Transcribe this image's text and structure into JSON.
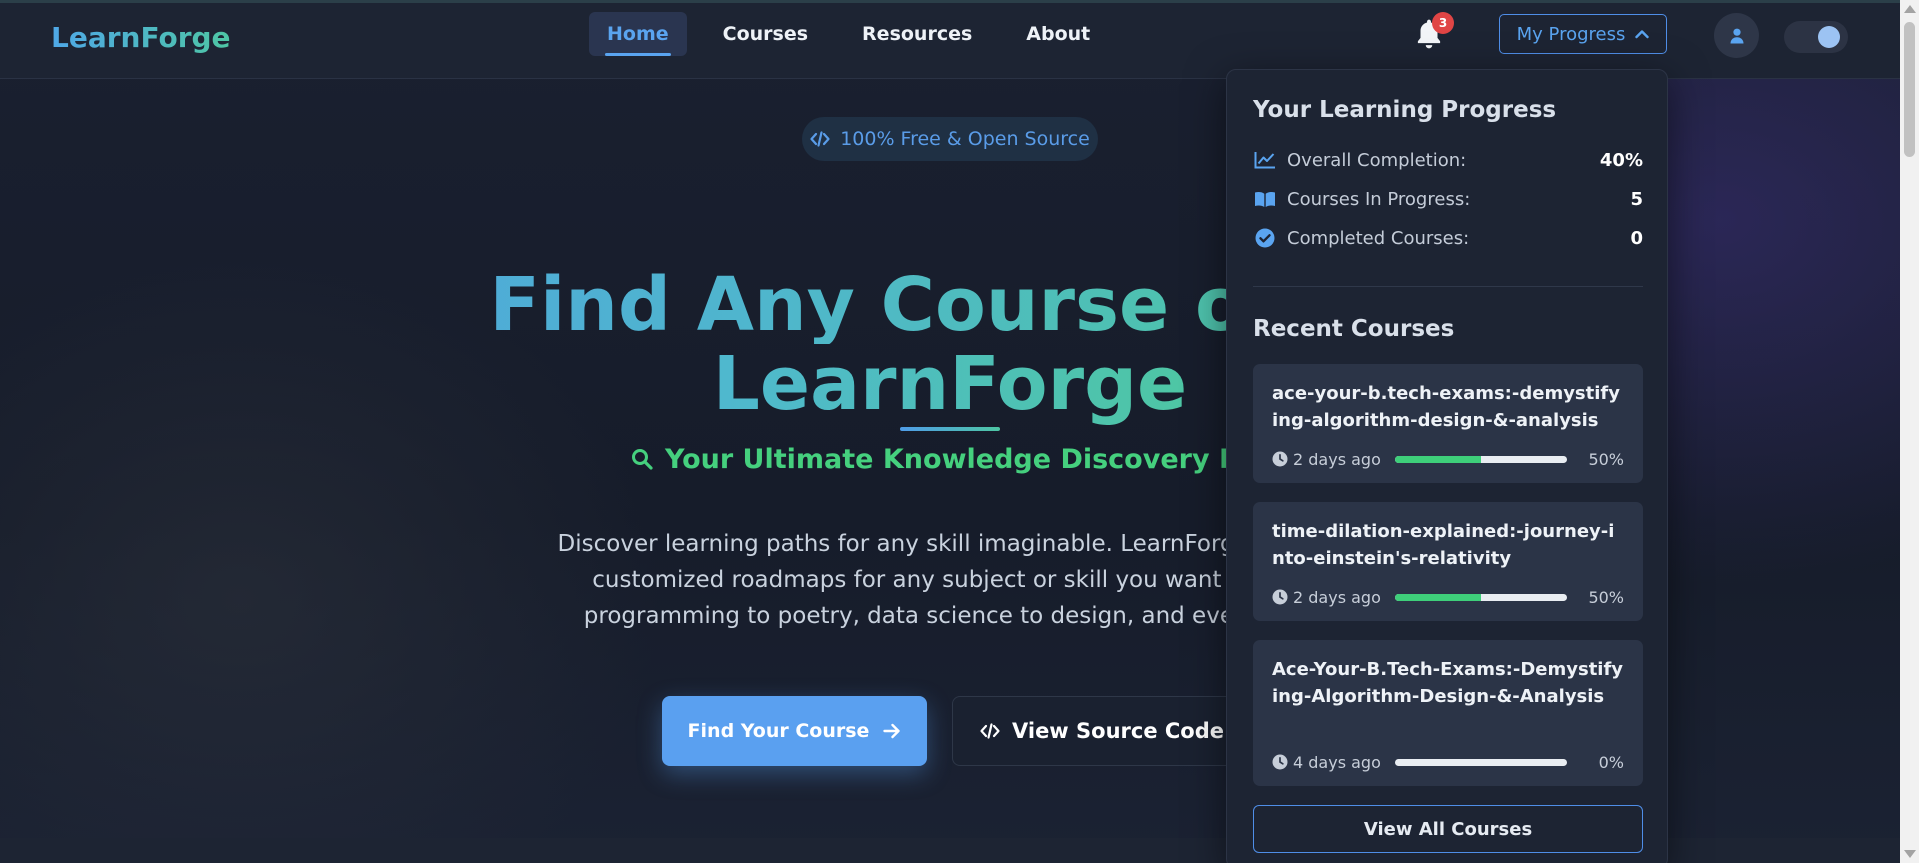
{
  "header": {
    "logo": "LearnForge",
    "nav": [
      {
        "label": "Home",
        "active": true
      },
      {
        "label": "Courses",
        "active": false
      },
      {
        "label": "Resources",
        "active": false
      },
      {
        "label": "About",
        "active": false
      }
    ],
    "notification_count": "3",
    "progress_button": "My Progress",
    "icons": {
      "bell": "bell-icon",
      "user": "user-icon",
      "chevron": "chevron-up-icon"
    }
  },
  "hero": {
    "badge": "100% Free & Open Source",
    "title_line1": "Find Any Course or Sk",
    "title_line2": "LearnForge",
    "tagline": "Your Ultimate Knowledge Discovery Platfo",
    "description_lines": [
      "Discover learning paths for any skill imaginable. LearnForge provide",
      "customized roadmaps for any subject or skill you want to mas",
      "programming to poetry, data science to design, and everything"
    ],
    "primary_button": "Find Your Course",
    "secondary_button": "View Source Code"
  },
  "progress_panel": {
    "title": "Your Learning Progress",
    "stats": [
      {
        "icon": "chart-line-icon",
        "label": "Overall Completion:",
        "value": "40%"
      },
      {
        "icon": "book-icon",
        "label": "Courses In Progress:",
        "value": "5"
      },
      {
        "icon": "check-circle-icon",
        "label": "Completed Courses:",
        "value": "0"
      }
    ],
    "recent_title": "Recent Courses",
    "courses": [
      {
        "title": "ace-your-b.tech-exams:-demystifying-algorithm-design-&-analysis",
        "time": "2 days ago",
        "progress": 0.5,
        "percent": "50%"
      },
      {
        "title": "time-dilation-explained:-journey-into-einstein's-relativity",
        "time": "2 days ago",
        "progress": 0.5,
        "percent": "50%"
      },
      {
        "title": "Ace-Your-B.Tech-Exams:-Demystifying-Algorithm-Design-&-Analysis",
        "time": "4 days ago",
        "progress": 0,
        "percent": "0%"
      }
    ],
    "view_all": "View All Courses"
  },
  "colors": {
    "accent": "#5aa0f0",
    "green": "#3ecf7a",
    "badge_red": "#e04545"
  }
}
